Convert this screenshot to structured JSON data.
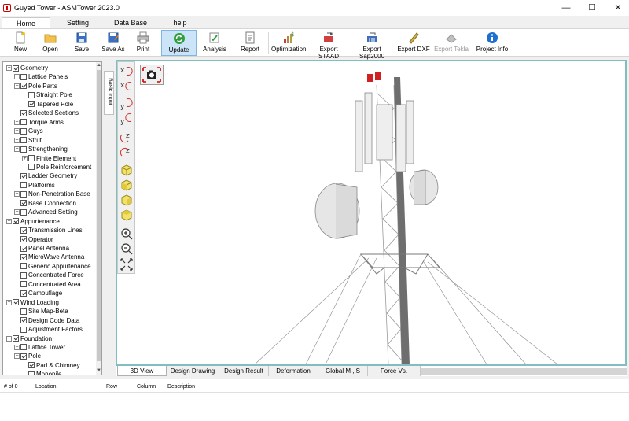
{
  "window": {
    "title": "Guyed Tower - ASMTower 2023.0",
    "minimize": "—",
    "maximize": "☐",
    "close": "✕"
  },
  "ribbon_tabs": [
    "Home",
    "Setting",
    "Data Base",
    "help"
  ],
  "toolbar": [
    {
      "label": "New",
      "icon": "new-file-icon"
    },
    {
      "label": "Open",
      "icon": "open-folder-icon"
    },
    {
      "label": "Save",
      "icon": "save-icon"
    },
    {
      "label": "Save As",
      "icon": "save-as-icon"
    },
    {
      "label": "Print",
      "icon": "print-icon"
    },
    {
      "label": "Update",
      "icon": "refresh-icon"
    },
    {
      "label": "Analysis",
      "icon": "analysis-icon"
    },
    {
      "label": "Report",
      "icon": "report-icon"
    },
    {
      "label": "Optimization",
      "icon": "optimization-icon"
    },
    {
      "label": "Export STAAD",
      "icon": "export-staad-icon"
    },
    {
      "label": "Export Sap2000",
      "icon": "export-sap-icon"
    },
    {
      "label": "Export DXF",
      "icon": "export-dxf-icon"
    },
    {
      "label": "Export Tekla",
      "icon": "export-tekla-icon"
    },
    {
      "label": "Project Info",
      "icon": "info-icon"
    }
  ],
  "tree": [
    {
      "label": "Geometry",
      "level": 0,
      "exp": "−",
      "checked": true
    },
    {
      "label": "Lattice Panels",
      "level": 1,
      "exp": "+",
      "checked": false
    },
    {
      "label": "Pole Parts",
      "level": 1,
      "exp": "−",
      "checked": true
    },
    {
      "label": "Straight Pole",
      "level": 2,
      "exp": "",
      "checked": false
    },
    {
      "label": "Tapered Pole",
      "level": 2,
      "exp": "",
      "checked": true
    },
    {
      "label": "Selected Sections",
      "level": 1,
      "exp": "",
      "checked": true
    },
    {
      "label": "Torque Arms",
      "level": 1,
      "exp": "+",
      "checked": false
    },
    {
      "label": "Guys",
      "level": 1,
      "exp": "+",
      "checked": false
    },
    {
      "label": "Strut",
      "level": 1,
      "exp": "+",
      "checked": false
    },
    {
      "label": "Strengthening",
      "level": 1,
      "exp": "−",
      "checked": false
    },
    {
      "label": "Finite Element",
      "level": 2,
      "exp": "+",
      "checked": false
    },
    {
      "label": "Pole Reinforcement",
      "level": 2,
      "exp": "",
      "checked": false
    },
    {
      "label": "Ladder Geometry",
      "level": 1,
      "exp": "",
      "checked": true
    },
    {
      "label": "Platforms",
      "level": 1,
      "exp": "",
      "checked": false
    },
    {
      "label": "Non-Penetration Base",
      "level": 1,
      "exp": "+",
      "checked": false
    },
    {
      "label": "Base Connection",
      "level": 1,
      "exp": "",
      "checked": true
    },
    {
      "label": "Advanced Setting",
      "level": 1,
      "exp": "+",
      "checked": false
    },
    {
      "label": "Appurtenance",
      "level": 0,
      "exp": "−",
      "checked": true
    },
    {
      "label": "Transmission Lines",
      "level": 1,
      "exp": "",
      "checked": true
    },
    {
      "label": "Operator",
      "level": 1,
      "exp": "",
      "checked": true
    },
    {
      "label": "Panel Antenna",
      "level": 1,
      "exp": "",
      "checked": true
    },
    {
      "label": "MicroWave Antenna",
      "level": 1,
      "exp": "",
      "checked": true
    },
    {
      "label": "Generic Appurtenance",
      "level": 1,
      "exp": "",
      "checked": false
    },
    {
      "label": "Concentrated Force",
      "level": 1,
      "exp": "",
      "checked": false
    },
    {
      "label": "Concentrated Area",
      "level": 1,
      "exp": "",
      "checked": false
    },
    {
      "label": "Camouflage",
      "level": 1,
      "exp": "",
      "checked": true
    },
    {
      "label": "Wind Loading",
      "level": 0,
      "exp": "−",
      "checked": true
    },
    {
      "label": "Site Map-Beta",
      "level": 1,
      "exp": "",
      "checked": false
    },
    {
      "label": "Design Code Data",
      "level": 1,
      "exp": "",
      "checked": true
    },
    {
      "label": "Adjustment Factors",
      "level": 1,
      "exp": "",
      "checked": false
    },
    {
      "label": "Foundation",
      "level": 0,
      "exp": "−",
      "checked": true
    },
    {
      "label": "Lattice Tower",
      "level": 1,
      "exp": "+",
      "checked": false
    },
    {
      "label": "Pole",
      "level": 1,
      "exp": "−",
      "checked": true
    },
    {
      "label": "Pad & Chimney",
      "level": 2,
      "exp": "",
      "checked": true
    },
    {
      "label": "Monopile",
      "level": 2,
      "exp": "",
      "checked": false
    }
  ],
  "side_tab": "Basic Input",
  "view_tools": [
    "rotate-x-positive-icon",
    "rotate-x-negative-icon",
    "rotate-y-positive-icon",
    "rotate-y-negative-icon",
    "rotate-z-positive-icon",
    "rotate-z-negative-icon",
    "view-iso-icon",
    "view-front-icon",
    "view-side-icon",
    "view-top-icon",
    "zoom-in-icon",
    "zoom-out-icon",
    "fit-all-icon"
  ],
  "camera_icon": "camera-icon",
  "bottom_tabs": [
    "3D View",
    "Design Drawing",
    "Design Result",
    "Deformation",
    "Global M , S",
    "Force Vs. Capacity"
  ],
  "grid_headers": [
    "# of 0",
    "Location",
    "Row",
    "Column",
    "Description"
  ],
  "colors": {
    "accent": "#0078d7",
    "viewport_border": "#7fbfbf",
    "antenna_red": "#d22020"
  }
}
